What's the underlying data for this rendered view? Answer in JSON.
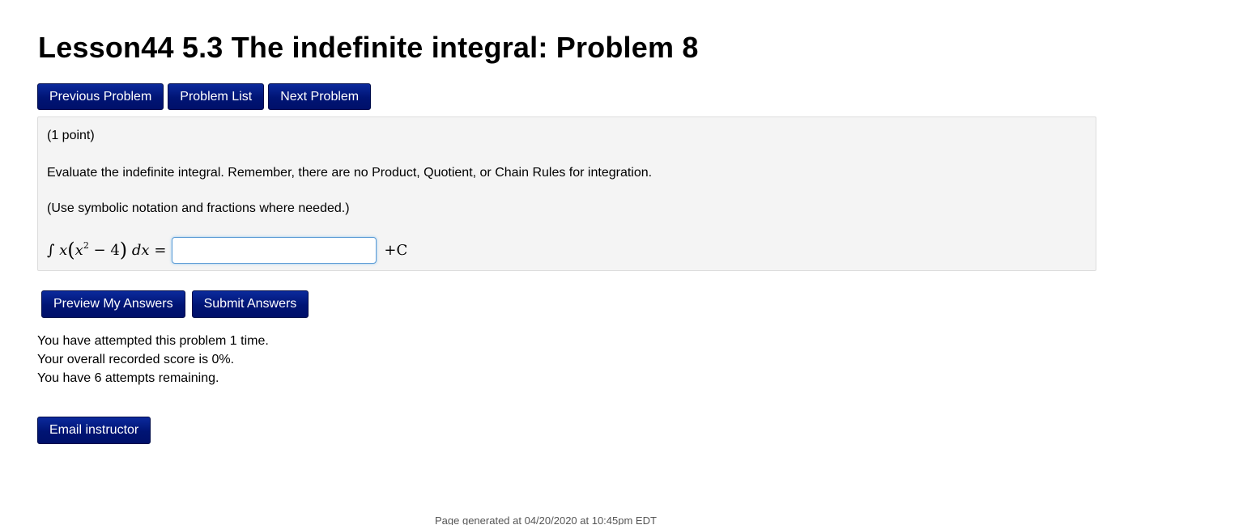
{
  "page_title": "Lesson44 5.3 The indefinite integral: Problem 8",
  "nav": {
    "previous_label": "Previous Problem",
    "list_label": "Problem List",
    "next_label": "Next Problem"
  },
  "problem": {
    "points": "(1 point)",
    "instructions": "Evaluate the indefinite integral. Remember, there are no Product, Quotient, or Chain Rules for integration.",
    "notation_note": "(Use symbolic notation and fractions where needed.)",
    "integral_sign": "∫",
    "integrand_var": "x",
    "inner_var": "x",
    "exponent": "2",
    "minus_four": " − 4",
    "differential": "dx",
    "equals": "=",
    "answer_value": "",
    "plus_c": "+C"
  },
  "actions": {
    "preview_label": "Preview My Answers",
    "submit_label": "Submit Answers"
  },
  "attempts": {
    "line1": "You have attempted this problem 1 time.",
    "line2": "Your overall recorded score is 0%.",
    "line3": "You have 6 attempts remaining."
  },
  "email_label": "Email instructor",
  "footer": "Page generated at 04/20/2020 at 10:45pm EDT",
  "colors": {
    "button_bg": "#001474",
    "panel_bg": "#f4f4f4",
    "input_border": "#5b9bd5"
  }
}
